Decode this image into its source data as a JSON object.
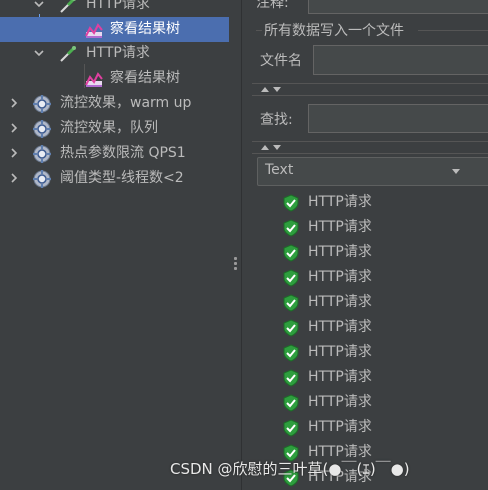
{
  "tree": {
    "items": [
      {
        "label": "HTTP请求",
        "icon": "dropper-icon",
        "arrow": "down"
      },
      {
        "label": "察看结果树",
        "icon": "view-results-tree-icon",
        "arrow": "none",
        "selected": true
      },
      {
        "label": "HTTP请求",
        "icon": "dropper-icon",
        "arrow": "down"
      },
      {
        "label": "察看结果树",
        "icon": "view-results-tree-icon",
        "arrow": "none"
      },
      {
        "label": "流控效果，warm up",
        "icon": "thread-group-gear-icon",
        "arrow": "right"
      },
      {
        "label": "流控效果，队列",
        "icon": "thread-group-gear-icon",
        "arrow": "right"
      },
      {
        "label": "热点参数限流 QPS1",
        "icon": "thread-group-gear-icon",
        "arrow": "right"
      },
      {
        "label": "阈值类型-线程数<2",
        "icon": "thread-group-gear-icon",
        "arrow": "right"
      }
    ]
  },
  "panel": {
    "comment_label": "注释:",
    "write_all_label": "所有数据写入一个文件",
    "filename_label": "文件名",
    "filename_value": "",
    "search_label": "查找:",
    "search_value": "",
    "renderer_selected": "Text"
  },
  "results": {
    "items": [
      "HTTP请求",
      "HTTP请求",
      "HTTP请求",
      "HTTP请求",
      "HTTP请求",
      "HTTP请求",
      "HTTP请求",
      "HTTP请求",
      "HTTP请求",
      "HTTP请求",
      "HTTP请求",
      "HTTP请求"
    ],
    "status": "success"
  },
  "watermark": "CSDN @欣慰的三叶草(●￣(ｴ)￣●)",
  "colors": {
    "background": "#3c3f41",
    "selection": "#4b6eaf",
    "success_green": "#2e9e3e",
    "text": "#bbbbbb"
  }
}
